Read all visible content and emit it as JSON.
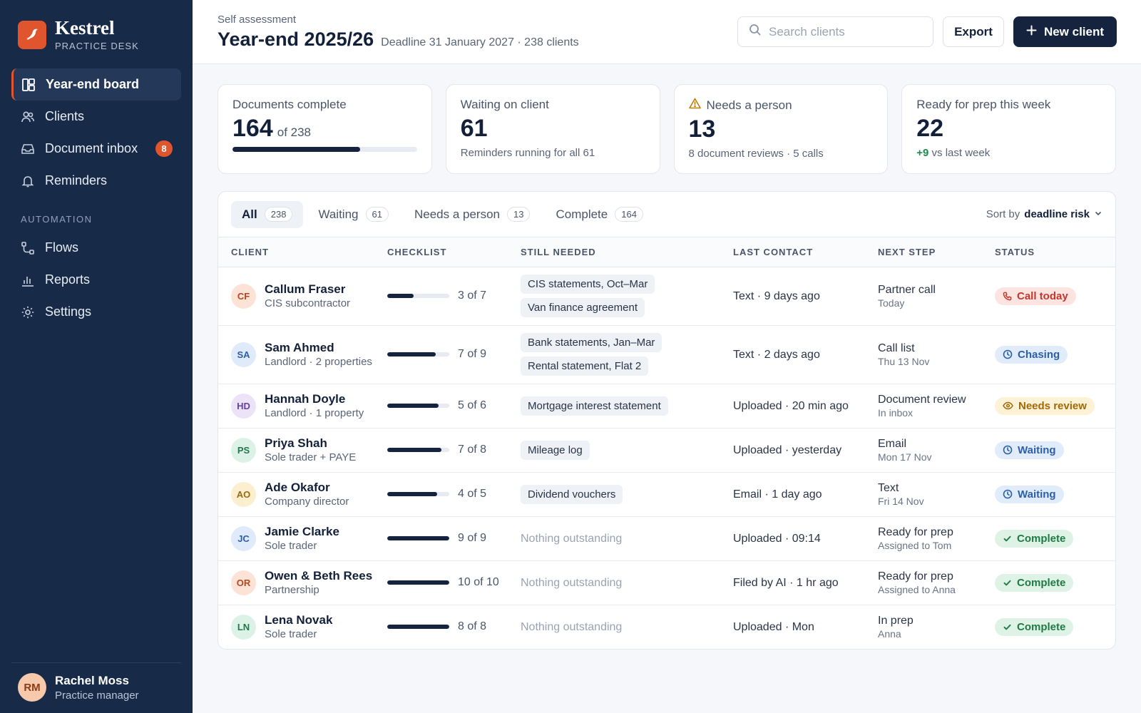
{
  "brand": {
    "name": "Kestrel",
    "subtitle": "PRACTICE DESK"
  },
  "sidebar": {
    "items": [
      {
        "label": "Year-end board",
        "icon": "board-icon",
        "active": true
      },
      {
        "label": "Clients",
        "icon": "users-icon"
      },
      {
        "label": "Document inbox",
        "icon": "inbox-icon",
        "badge": "8"
      },
      {
        "label": "Reminders",
        "icon": "bell-icon"
      }
    ],
    "section_label": "AUTOMATION",
    "automation_items": [
      {
        "label": "Flows",
        "icon": "flow-icon"
      },
      {
        "label": "Reports",
        "icon": "chart-icon"
      },
      {
        "label": "Settings",
        "icon": "gear-icon"
      }
    ],
    "user": {
      "initials": "RM",
      "name": "Rachel Moss",
      "role": "Practice manager"
    }
  },
  "header": {
    "eyebrow": "Self assessment",
    "title": "Year-end 2025/26",
    "meta": "Deadline 31 January 2027 · 238 clients",
    "search_placeholder": "Search clients",
    "export_label": "Export",
    "new_client_label": "New client"
  },
  "stats": {
    "documents": {
      "label": "Documents complete",
      "value": "164",
      "of": "of 238",
      "progress": 0.69
    },
    "waiting": {
      "label": "Waiting on client",
      "value": "61",
      "note": "Reminders running for all 61"
    },
    "needs": {
      "label": "Needs a person",
      "value": "13",
      "note": "8 document reviews · 5 calls"
    },
    "ready": {
      "label": "Ready for prep this week",
      "value": "22",
      "delta": "+9",
      "note": "vs last week"
    }
  },
  "tabs": [
    {
      "label": "All",
      "count": "238",
      "active": true
    },
    {
      "label": "Waiting",
      "count": "61"
    },
    {
      "label": "Needs a person",
      "count": "13"
    },
    {
      "label": "Complete",
      "count": "164"
    }
  ],
  "sort": {
    "prefix": "Sort by",
    "value": "deadline risk"
  },
  "table": {
    "headers": [
      "CLIENT",
      "CHECKLIST",
      "STILL NEEDED",
      "LAST CONTACT",
      "NEXT STEP",
      "STATUS"
    ],
    "rows": [
      {
        "initials": "CF",
        "avatar_bg": "#fde3d6",
        "avatar_fg": "#b5461f",
        "name": "Callum Fraser",
        "type": "CIS subcontractor",
        "done": 3,
        "total": 7,
        "checklist": "3 of 7",
        "needed": [
          "CIS statements, Oct–Mar",
          "Van finance agreement"
        ],
        "contact": "Text · 9 days ago",
        "next": "Partner call",
        "next_sub": "Today",
        "status": "Call today",
        "status_kind": "call"
      },
      {
        "initials": "SA",
        "avatar_bg": "#dfeafb",
        "avatar_fg": "#2d5fa6",
        "name": "Sam Ahmed",
        "type": "Landlord · 2 properties",
        "done": 7,
        "total": 9,
        "checklist": "7 of 9",
        "needed": [
          "Bank statements, Jan–Mar",
          "Rental statement, Flat 2"
        ],
        "contact": "Text · 2 days ago",
        "next": "Call list",
        "next_sub": "Thu 13 Nov",
        "status": "Chasing",
        "status_kind": "clock"
      },
      {
        "initials": "HD",
        "avatar_bg": "#ece3f8",
        "avatar_fg": "#6a3fa3",
        "name": "Hannah Doyle",
        "type": "Landlord · 1 property",
        "done": 5,
        "total": 6,
        "checklist": "5 of 6",
        "needed": [
          "Mortgage interest statement"
        ],
        "contact": "Uploaded · 20 min ago",
        "next": "Document review",
        "next_sub": "In inbox",
        "status": "Needs review",
        "status_kind": "review"
      },
      {
        "initials": "PS",
        "avatar_bg": "#dcf2e6",
        "avatar_fg": "#23774a",
        "name": "Priya Shah",
        "type": "Sole trader + PAYE",
        "done": 7,
        "total": 8,
        "checklist": "7 of 8",
        "needed": [
          "Mileage log"
        ],
        "contact": "Uploaded · yesterday",
        "next": "Email",
        "next_sub": "Mon 17 Nov",
        "status": "Waiting",
        "status_kind": "clock"
      },
      {
        "initials": "AO",
        "avatar_bg": "#fbefcf",
        "avatar_fg": "#9a6b0c",
        "name": "Ade Okafor",
        "type": "Company director",
        "done": 4,
        "total": 5,
        "checklist": "4 of 5",
        "needed": [
          "Dividend vouchers"
        ],
        "contact": "Email · 1 day ago",
        "next": "Text",
        "next_sub": "Fri 14 Nov",
        "status": "Waiting",
        "status_kind": "clock"
      },
      {
        "initials": "JC",
        "avatar_bg": "#dfeafb",
        "avatar_fg": "#2d5fa6",
        "name": "Jamie Clarke",
        "type": "Sole trader",
        "done": 9,
        "total": 9,
        "checklist": "9 of 9",
        "needed": [],
        "empty": "Nothing outstanding",
        "contact": "Uploaded · 09:14",
        "next": "Ready for prep",
        "next_sub": "Assigned to Tom",
        "status": "Complete",
        "status_kind": "done"
      },
      {
        "initials": "OR",
        "avatar_bg": "#fde3d6",
        "avatar_fg": "#b5461f",
        "name": "Owen & Beth Rees",
        "type": "Partnership",
        "done": 10,
        "total": 10,
        "checklist": "10 of 10",
        "needed": [],
        "empty": "Nothing outstanding",
        "contact": "Filed by AI · 1 hr ago",
        "next": "Ready for prep",
        "next_sub": "Assigned to Anna",
        "status": "Complete",
        "status_kind": "done"
      },
      {
        "initials": "LN",
        "avatar_bg": "#dcf2e6",
        "avatar_fg": "#23774a",
        "name": "Lena Novak",
        "type": "Sole trader",
        "done": 8,
        "total": 8,
        "checklist": "8 of 8",
        "needed": [],
        "empty": "Nothing outstanding",
        "contact": "Uploaded · Mon",
        "next": "In prep",
        "next_sub": "Anna",
        "status": "Complete",
        "status_kind": "done"
      }
    ]
  },
  "colors": {
    "sidebar_bg": "#172a47",
    "accent": "#e0552e",
    "primary": "#15233f",
    "status_call_bg": "#fde4e1",
    "status_call_fg": "#c2372b",
    "status_clock_bg": "#e1ecfb",
    "status_clock_fg": "#2d5fa6",
    "status_review_bg": "#fdf1d6",
    "status_review_fg": "#a06a06",
    "status_done_bg": "#def3e6",
    "status_done_fg": "#1f7a45",
    "positive": "#1f8a4c"
  }
}
